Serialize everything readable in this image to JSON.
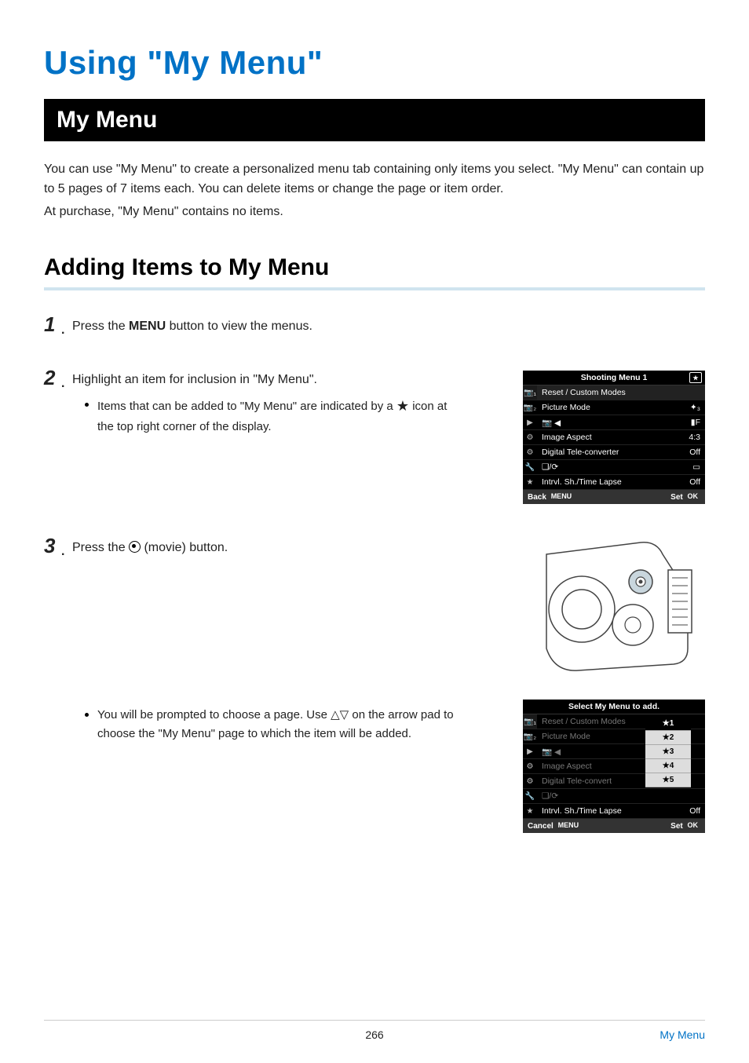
{
  "chapter_title": "Using \"My Menu\"",
  "section_title": "My Menu",
  "intro_1": "You can use \"My Menu\" to create a personalized menu tab containing only items you select. \"My Menu\" can contain up to 5 pages of 7 items each. You can delete items or change the page or item order.",
  "intro_2": "At purchase, \"My Menu\" contains no items.",
  "subsection_title": "Adding Items to My Menu",
  "steps": {
    "s1": {
      "num": "1",
      "pre": "Press the ",
      "bold": "MENU",
      "post": " button to view the menus."
    },
    "s2": {
      "num": "2",
      "text": "Highlight an item for inclusion in \"My Menu\".",
      "bullet_a_pre": "Items that can be added to \"My Menu\" are indicated by a ",
      "bullet_a_post": " icon at the top right corner of the display."
    },
    "s3": {
      "num": "3",
      "pre": "Press the ",
      "post": " (movie) button."
    },
    "s3b": {
      "pre": "You will be prompted to choose a page. Use ",
      "post": " on the arrow pad to choose the \"My Menu\" page to which the item will be added."
    }
  },
  "menu1": {
    "title": "Shooting Menu 1",
    "rows": [
      {
        "l": "Reset / Custom Modes",
        "r": ""
      },
      {
        "l": "Picture Mode",
        "r": "✦₃"
      },
      {
        "l": "📷 ◀",
        "r": "▮F"
      },
      {
        "l": "Image Aspect",
        "r": "4:3"
      },
      {
        "l": "Digital Tele-converter",
        "r": "Off"
      },
      {
        "l": "❑/⟳",
        "r": "▭"
      },
      {
        "l": "Intrvl. Sh./Time Lapse",
        "r": "Off"
      }
    ],
    "back": "Back",
    "back_btn": "MENU",
    "set": "Set",
    "set_btn": "OK"
  },
  "menu2": {
    "title": "Select My Menu to add.",
    "rows": [
      {
        "l": "Reset / Custom Modes",
        "r": ""
      },
      {
        "l": "Picture Mode",
        "r": ""
      },
      {
        "l": "📷 ◀",
        "r": ""
      },
      {
        "l": "Image Aspect",
        "r": ""
      },
      {
        "l": "Digital Tele-convert",
        "r": ""
      },
      {
        "l": "❑/⟳",
        "r": ""
      },
      {
        "l": "Intrvl. Sh./Time Lapse",
        "r": "Off"
      }
    ],
    "options": [
      "★1",
      "★2",
      "★3",
      "★4",
      "★5"
    ],
    "back": "Cancel",
    "back_btn": "MENU",
    "set": "Set",
    "set_btn": "OK"
  },
  "side_icons": [
    "📷₁",
    "📷₂",
    "▶",
    "⚙",
    "⚙",
    "🔧",
    "★"
  ],
  "footer": {
    "page": "266",
    "link": "My Menu"
  }
}
